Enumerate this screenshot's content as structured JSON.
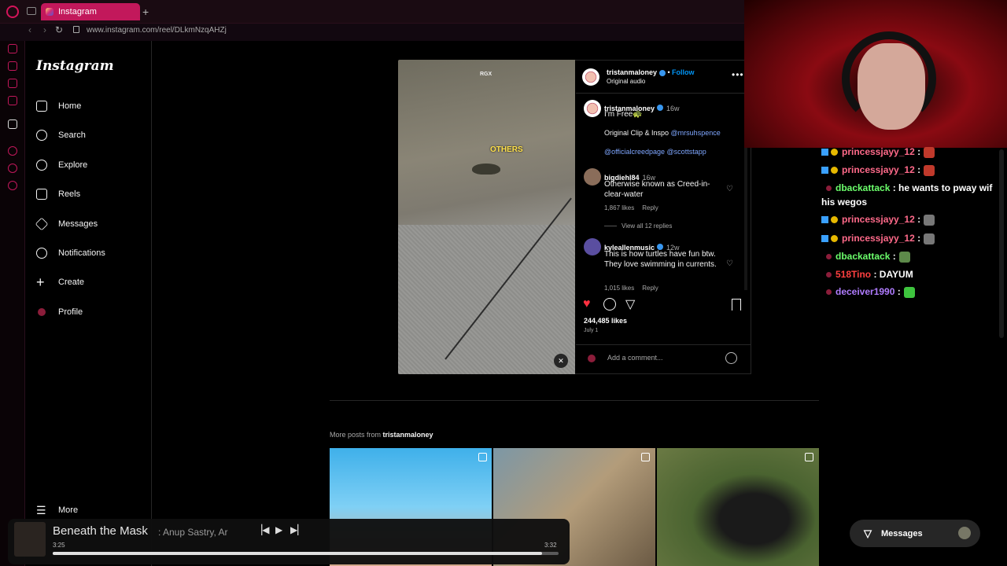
{
  "browser": {
    "tab_title": "Instagram",
    "url": "www.instagram.com/reel/DLkmNzqAHZj"
  },
  "nav": {
    "logo": "Instagram",
    "items": [
      {
        "label": "Home",
        "icon": "home-icon"
      },
      {
        "label": "Search",
        "icon": "search-icon"
      },
      {
        "label": "Explore",
        "icon": "compass-icon"
      },
      {
        "label": "Reels",
        "icon": "reels-icon"
      },
      {
        "label": "Messages",
        "icon": "send-icon"
      },
      {
        "label": "Notifications",
        "icon": "heart-icon"
      },
      {
        "label": "Create",
        "icon": "plus-icon"
      },
      {
        "label": "Profile",
        "icon": "avatar"
      }
    ],
    "more_label": "More"
  },
  "post": {
    "video_watermark": "RGX",
    "video_caption": "OTHERS",
    "author": "tristanmaloney",
    "follow_label": "Follow",
    "audio": "Original audio",
    "caption": {
      "author": "tristanmaloney",
      "age": "16w",
      "text": "I'm Free🐢",
      "line2_prefix": "Original Clip & Inspo ",
      "mention1": "@mrsuhspence",
      "mention2": "@officialcreedpage",
      "mention3": "@scottstapp"
    },
    "comments": [
      {
        "user": "bigdiehl84",
        "age": "16w",
        "text": "Otherwise known as Creed-in-clear-water",
        "likes": "1,867 likes",
        "reply": "Reply",
        "view_replies": "View all 12 replies"
      },
      {
        "user": "kyleallenmusic",
        "age": "12w",
        "text": "This is how turtles have fun btw. They love swimming in currents.",
        "likes": "1,015 likes",
        "reply": "Reply"
      }
    ],
    "likes": "244,485 likes",
    "date": "July 1",
    "comment_placeholder": "Add a comment..."
  },
  "more_posts": {
    "prefix": "More posts from ",
    "user": "tristanmaloney"
  },
  "player": {
    "title": "Beneath the Mask",
    "artist": ": Anup Sastry, Ar",
    "elapsed": "3:25",
    "total": "3:32",
    "progress": 0.967
  },
  "chat": [
    {
      "user": "princessjayy_12",
      "sep": " :",
      "text": "",
      "color": "#ff6a8a"
    },
    {
      "user": "princessjayy_12",
      "sep": " :",
      "text": "",
      "color": "#ff6a8a"
    },
    {
      "user": "dbackattack",
      "sep": " :",
      "text": " he wants to pway wif his wegos",
      "color": "#6cff6c"
    },
    {
      "user": "princessjayy_12",
      "sep": " :",
      "text": "",
      "color": "#ff6a8a"
    },
    {
      "user": "princessjayy_12",
      "sep": " :",
      "text": "",
      "color": "#ff6a8a"
    },
    {
      "user": "dbackattack",
      "sep": " :",
      "text": "",
      "color": "#6cff6c"
    },
    {
      "user": "518Tino",
      "sep": " :",
      "text": " DAYUM",
      "color": "#ff4040"
    },
    {
      "user": "deceiver1990",
      "sep": " :",
      "text": "",
      "color": "#b07cff"
    }
  ],
  "messages_button": "Messages",
  "colors": {
    "accent": "#c2185b",
    "link": "#0095f6",
    "like": "#ff3040"
  }
}
